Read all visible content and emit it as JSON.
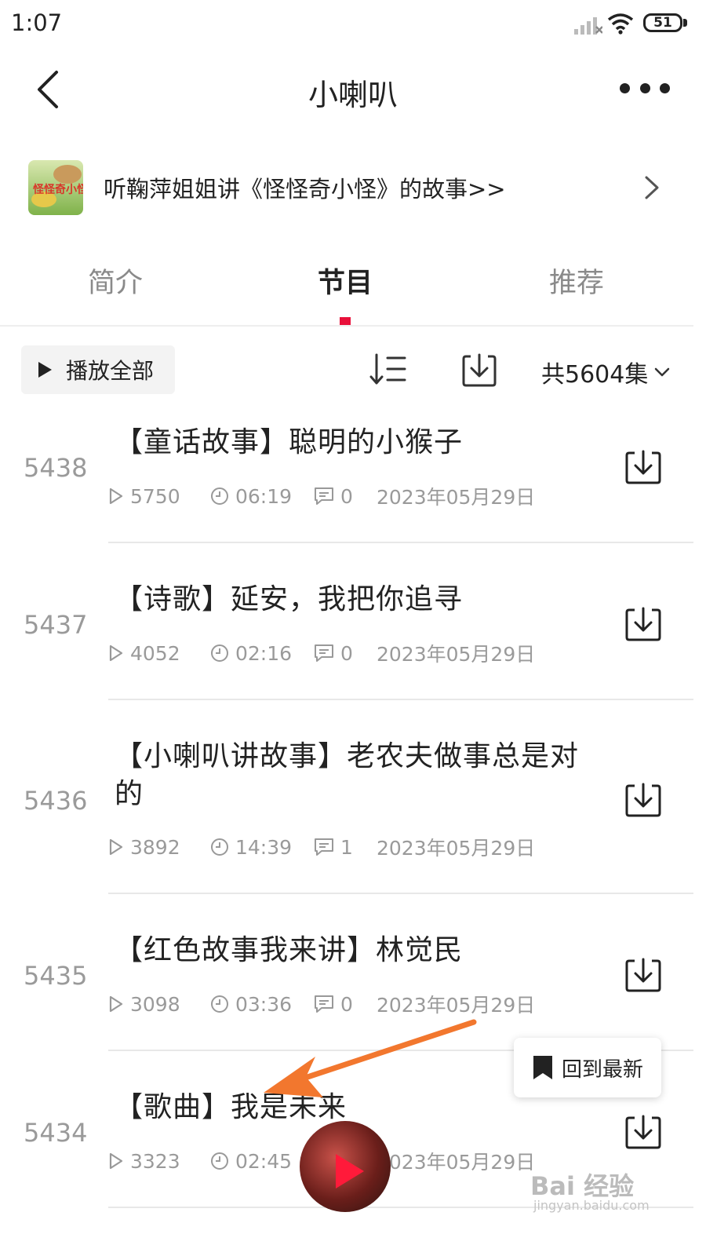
{
  "status_bar": {
    "time": "1:07",
    "battery": "51"
  },
  "header": {
    "title": "小喇叭"
  },
  "album": {
    "text": "听鞠萍姐姐讲《怪怪奇小怪》的故事>>",
    "cover_text": "怪怪奇小怪"
  },
  "tabs": [
    {
      "label": "简介"
    },
    {
      "label": "节目"
    },
    {
      "label": "推荐"
    }
  ],
  "toolbar": {
    "play_all": "播放全部",
    "count": "共5604集"
  },
  "episodes": [
    {
      "num": "5438",
      "title": "【童话故事】聪明的小猴子",
      "plays": "5750",
      "duration": "06:19",
      "comments": "0",
      "date": "2023年05月29日"
    },
    {
      "num": "5437",
      "title": "【诗歌】延安，我把你追寻",
      "plays": "4052",
      "duration": "02:16",
      "comments": "0",
      "date": "2023年05月29日"
    },
    {
      "num": "5436",
      "title": "【小喇叭讲故事】老农夫做事总是对的",
      "plays": "3892",
      "duration": "14:39",
      "comments": "1",
      "date": "2023年05月29日"
    },
    {
      "num": "5435",
      "title": "【红色故事我来讲】林觉民",
      "plays": "3098",
      "duration": "03:36",
      "comments": "0",
      "date": "2023年05月29日"
    },
    {
      "num": "5434",
      "title": "【歌曲】我是未来",
      "plays": "3323",
      "duration": "02:45",
      "comments": "",
      "date": "2023年05月29日"
    }
  ],
  "floating": {
    "back_to_latest": "回到最新"
  },
  "watermark": {
    "main": "Bai 经验",
    "sub": "jingyan.baidu.com"
  },
  "colors": {
    "accent": "#e8103a",
    "annotation_arrow": "#f2772e"
  }
}
